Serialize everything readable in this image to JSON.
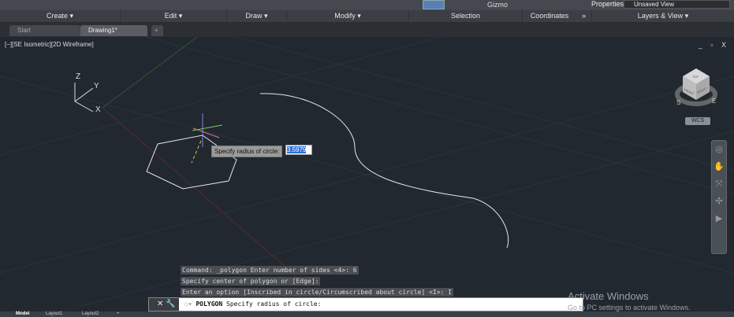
{
  "ribbon": {
    "groups": [
      "Create ▾",
      "Edit ▾",
      "Draw ▾",
      "Modify ▾",
      "Selection",
      "Coordinates",
      "»",
      "Layers & View ▾"
    ],
    "gizmo": "Gizmo",
    "properties": "Properties",
    "view_select": "Unsaved View"
  },
  "tabs": [
    {
      "label": "Start"
    },
    {
      "label": "Drawing1*"
    }
  ],
  "viewport": {
    "label": "[−][SE Isometric][2D Wireframe]",
    "window_controls": "_ ▫ X",
    "tooltip": "Specify radius of circle:",
    "tooltip_value": "3.5979",
    "wcs": "WCS",
    "cube_labels": {
      "top": "TOP",
      "front": "FRONT",
      "right": "RIGHT",
      "s": "S",
      "e": "E"
    },
    "axes": {
      "x": "X",
      "y": "Y",
      "z": "Z"
    }
  },
  "command": {
    "history": [
      "Command: _polygon Enter number of sides <4>: 6",
      "Specify center of polygon or [Edge]:",
      "Enter an option [Inscribed in circle/Circumscribed about circle] <I>: I"
    ],
    "prompt_cmd": "POLYGON",
    "prompt_text": "Specify radius of circle:"
  },
  "watermark": {
    "title": "Activate Windows",
    "subtitle": "Go to PC settings to activate Windows."
  },
  "layouts": [
    "Model",
    "Layout1",
    "Layout2",
    "+"
  ]
}
